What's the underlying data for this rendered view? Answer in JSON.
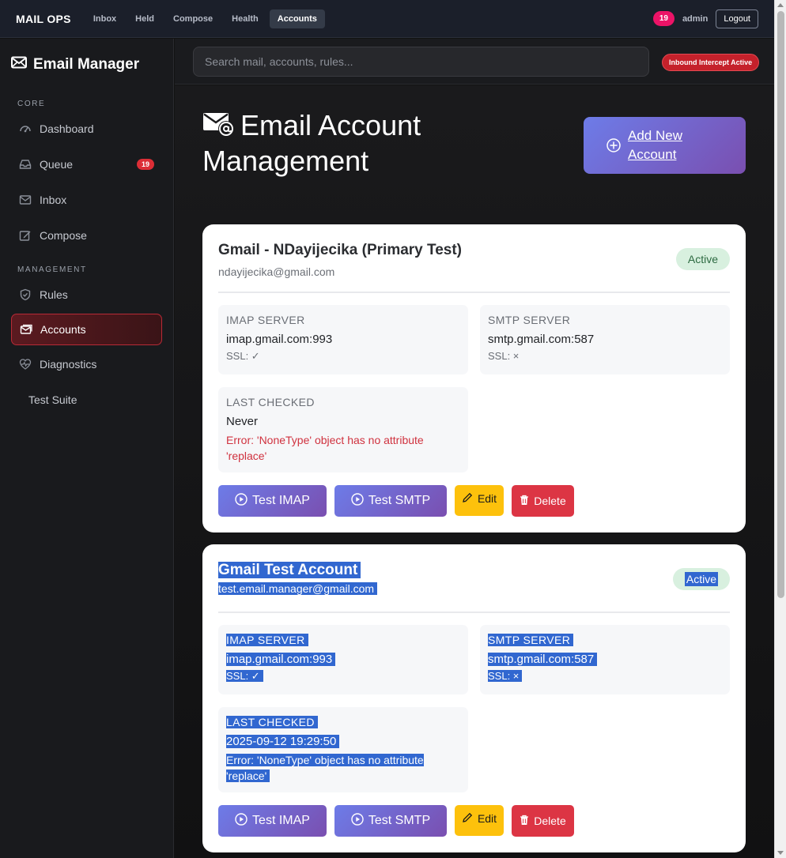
{
  "topnav": {
    "brand": "MAIL OPS",
    "links": [
      "Inbox",
      "Held",
      "Compose",
      "Health",
      "Accounts"
    ],
    "count_badge": "19",
    "user": "admin",
    "logout": "Logout"
  },
  "sidebar": {
    "title": "Email Manager",
    "sections": [
      "CORE",
      "MANAGEMENT"
    ],
    "items": [
      {
        "label": "Dashboard",
        "icon": "gauge-icon"
      },
      {
        "label": "Queue",
        "icon": "inbox-tray-icon",
        "badge": "19"
      },
      {
        "label": "Inbox",
        "icon": "envelope-icon"
      },
      {
        "label": "Compose",
        "icon": "pencil-square-icon"
      },
      {
        "label": "Rules",
        "icon": "shield-icon"
      },
      {
        "label": "Accounts",
        "icon": "envelope-stack-icon"
      },
      {
        "label": "Diagnostics",
        "icon": "heart-pulse-icon"
      },
      {
        "label": "Test Suite"
      }
    ]
  },
  "search": {
    "placeholder": "Search mail, accounts, rules..."
  },
  "intercept_badge": "Inbound Intercept Active",
  "page": {
    "title_line1": "Email Account",
    "title_line2": "Management",
    "add_button": "Add New Account"
  },
  "accounts": [
    {
      "name": "Gmail - NDayijecika (Primary Test)",
      "email": "ndayijecika@gmail.com",
      "status": "Active",
      "imap_label": "IMAP SERVER",
      "imap": "imap.gmail.com:993",
      "imap_ssl": "SSL: ✓",
      "smtp_label": "SMTP SERVER",
      "smtp": "smtp.gmail.com:587",
      "smtp_ssl": "SSL: ×",
      "last_checked_label": "LAST CHECKED",
      "last_checked": "Never",
      "error": "Error: 'NoneType' object has no attribute 'replace'",
      "buttons": {
        "test_imap": "Test IMAP",
        "test_smtp": "Test SMTP",
        "edit": "Edit",
        "delete": "Delete"
      }
    },
    {
      "name": "Gmail Test Account",
      "email": "test.email.manager@gmail.com",
      "status": "Active",
      "imap_label": "IMAP SERVER",
      "imap": "imap.gmail.com:993",
      "imap_ssl": "SSL: ✓",
      "smtp_label": "SMTP SERVER",
      "smtp": "smtp.gmail.com:587",
      "smtp_ssl": "SSL: ×",
      "last_checked_label": "LAST CHECKED",
      "last_checked": "2025-09-12 19:29:50",
      "error": "Error: 'NoneType' object has no attribute 'replace'",
      "buttons": {
        "test_imap": "Test IMAP",
        "test_smtp": "Test SMTP",
        "edit": "Edit",
        "delete": "Delete"
      }
    }
  ],
  "colors": {
    "accent_gradient_start": "#6d7ce8",
    "accent_gradient_end": "#7a4fb0",
    "danger": "#dc3544",
    "warning": "#fdc10c",
    "active_status_bg": "#d8f0df"
  }
}
